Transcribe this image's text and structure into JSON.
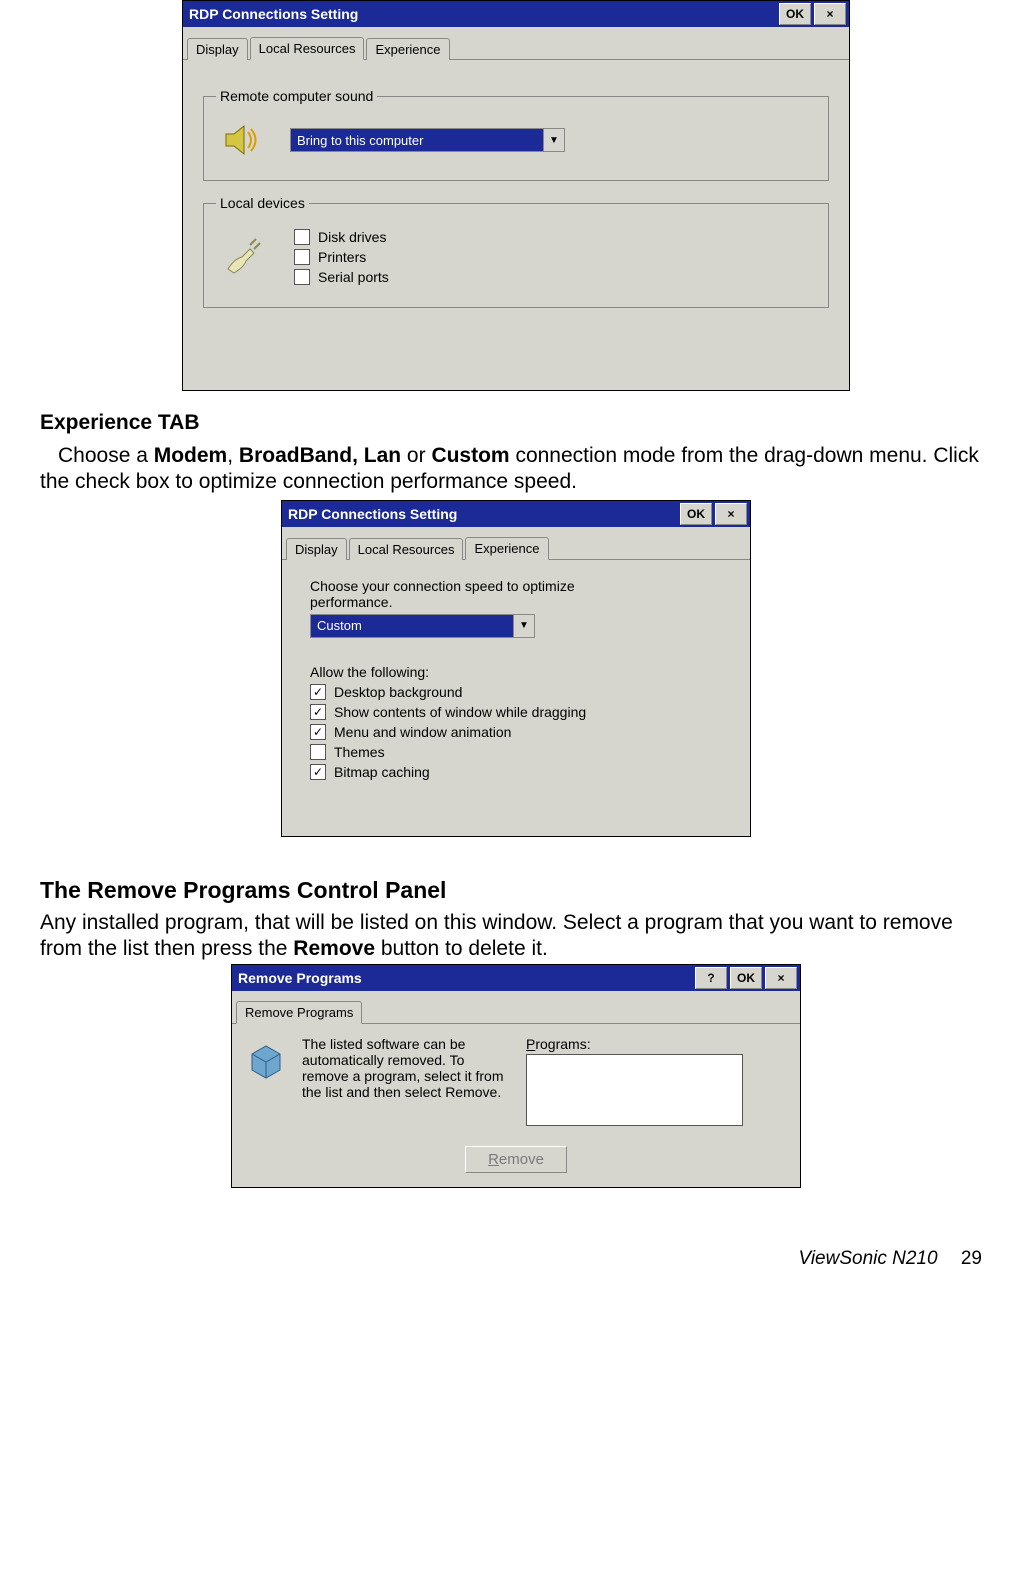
{
  "dialog1": {
    "title": "RDP Connections Setting",
    "ok": "OK",
    "close": "×",
    "tabs": {
      "display": "Display",
      "local": "Local Resources",
      "experience": "Experience"
    },
    "group_sound": "Remote computer sound",
    "sound_value": "Bring to this computer",
    "group_local": "Local devices",
    "cb_disk": "Disk drives",
    "cb_printers": "Printers",
    "cb_serial": "Serial ports"
  },
  "text1": {
    "heading": "Experience TAB",
    "para_a": "Choose a ",
    "para_b": "Modem",
    "para_c": ", ",
    "para_d": "BroadBand, Lan",
    "para_e": " or ",
    "para_f": "Custom",
    "para_g": " connection mode from the drag-down menu. Click the check box to optimize connection performance speed."
  },
  "dialog2": {
    "title": "RDP Connections Setting",
    "ok": "OK",
    "close": "×",
    "tabs": {
      "display": "Display",
      "local": "Local Resources",
      "experience": "Experience"
    },
    "instr1": "Choose your connection speed to optimize performance.",
    "combo_value": "Custom",
    "allow": "Allow the following:",
    "cb_bg": "Desktop background",
    "cb_drag": "Show contents of window while dragging",
    "cb_anim": "Menu and window animation",
    "cb_themes": "Themes",
    "cb_bitmap": "Bitmap caching"
  },
  "text2": {
    "heading": "The Remove Programs Control Panel",
    "para_a": "Any installed program, that will be listed on this window. Select a program that you want to remove from the list then press the ",
    "para_b": "Remove",
    "para_c": " button to delete it."
  },
  "dialog3": {
    "title": "Remove Programs",
    "help": "?",
    "ok": "OK",
    "close": "×",
    "tab": "Remove Programs",
    "desc": "The listed software can be automatically removed. To remove a program, select it from the list and then select Remove.",
    "programs_label": "Programs:",
    "remove_btn_u": "R",
    "remove_btn_rest": "emove"
  },
  "footer": {
    "brand": "ViewSonic   N210",
    "page": "29"
  }
}
